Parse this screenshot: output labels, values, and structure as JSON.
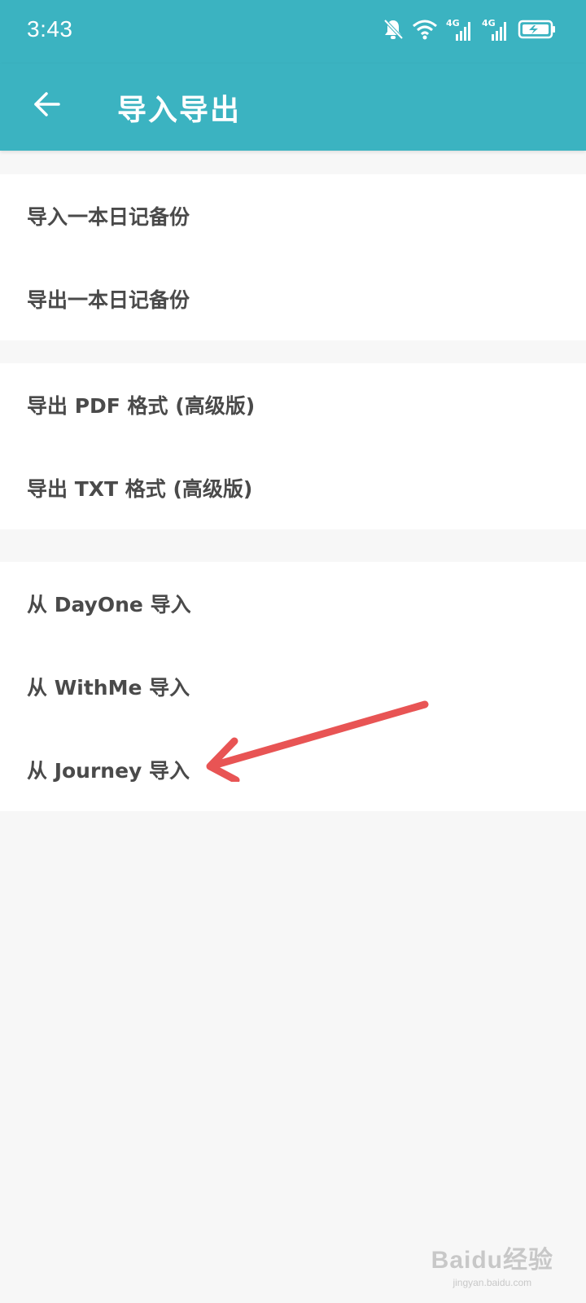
{
  "status_bar": {
    "time": "3:43",
    "network_label_1": "4G",
    "network_label_2": "4G",
    "icons": [
      "bell-off-icon",
      "wifi-icon",
      "signal-4g-icon",
      "signal-4g-icon",
      "battery-charging-icon"
    ]
  },
  "toolbar": {
    "title": "导入导出",
    "back_icon": "arrow-left-icon"
  },
  "groups": [
    {
      "items": [
        {
          "label": "导入一本日记备份"
        },
        {
          "label": "导出一本日记备份"
        }
      ]
    },
    {
      "items": [
        {
          "label": "导出 PDF 格式 (高级版)"
        },
        {
          "label": "导出 TXT 格式 (高级版)"
        }
      ]
    },
    {
      "items": [
        {
          "label": "从 DayOne 导入"
        },
        {
          "label": "从 WithMe 导入"
        },
        {
          "label": "从 Journey 导入"
        }
      ]
    }
  ],
  "annotation": {
    "color": "#e85454"
  },
  "watermark": {
    "logo": "Baidu经验",
    "url": "jingyan.baidu.com"
  },
  "colors": {
    "primary": "#3bb3c1",
    "background": "#f7f7f7",
    "item_text": "#4a4a4a"
  }
}
